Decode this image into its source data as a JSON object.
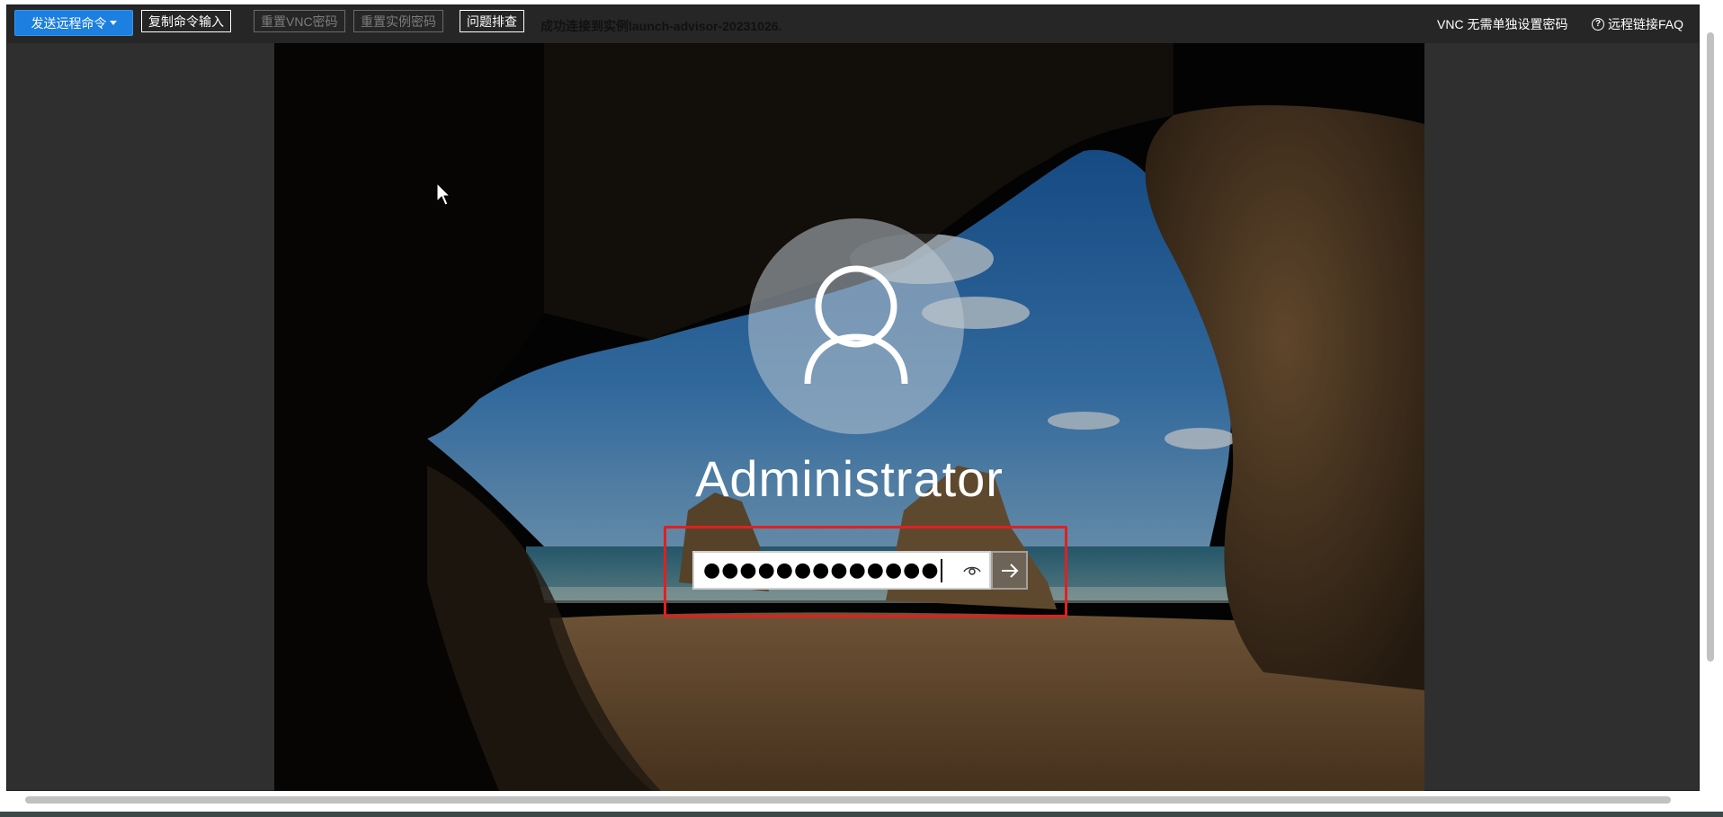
{
  "toolbar": {
    "send_command_label": "发送远程命令",
    "copy_input_label": "复制命令输入",
    "reset_vnc_label": "重置VNC密码",
    "reset_instance_label": "重置实例密码",
    "troubleshoot_label": "问题排查",
    "status_message": "成功连接到实例launch-advisor-20231026.",
    "vnc_no_password_label": "VNC 无需单独设置密码",
    "faq_label": "远程链接FAQ",
    "help_icon_glyph": "?"
  },
  "login_screen": {
    "username": "Administrator",
    "password_masked": "●●●●●●●●●●●●●",
    "icons": [
      "user-avatar-icon",
      "eye-icon",
      "arrow-right-icon",
      "mouse-cursor-icon"
    ]
  },
  "colors": {
    "primary_button": "#1d7fe0",
    "highlight_border": "#e02020",
    "toolbar_bg": "#262626"
  }
}
